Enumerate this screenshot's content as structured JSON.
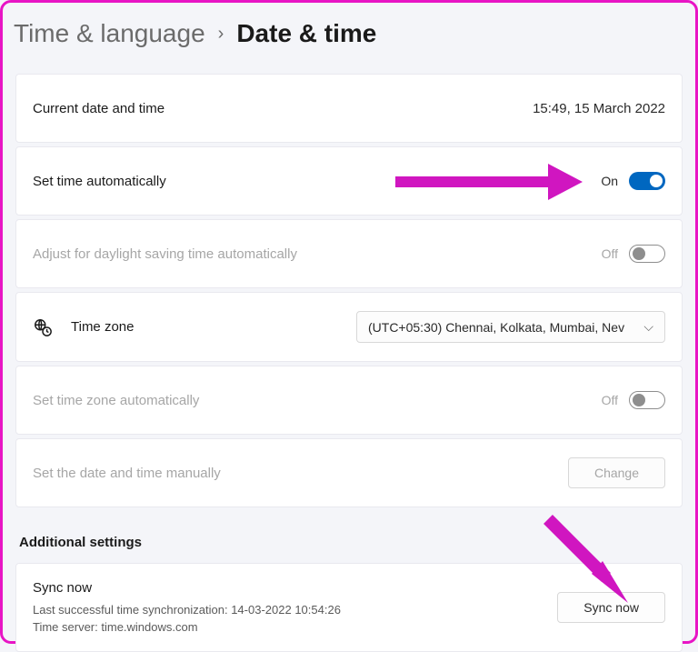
{
  "breadcrumb": {
    "parent": "Time & language",
    "current": "Date & time"
  },
  "rows": {
    "current": {
      "label": "Current date and time",
      "value": "15:49, 15 March 2022"
    },
    "set_auto": {
      "label": "Set time automatically",
      "state": "On"
    },
    "dst": {
      "label": "Adjust for daylight saving time automatically",
      "state": "Off"
    },
    "tz": {
      "label": "Time zone",
      "value": "(UTC+05:30) Chennai, Kolkata, Mumbai, Nev"
    },
    "tz_auto": {
      "label": "Set time zone automatically",
      "state": "Off"
    },
    "manual": {
      "label": "Set the date and time manually",
      "button": "Change"
    }
  },
  "additional": {
    "heading": "Additional settings",
    "sync": {
      "title": "Sync now",
      "last": "Last successful time synchronization: 14-03-2022 10:54:26",
      "server": "Time server: time.windows.com",
      "button": "Sync now"
    }
  }
}
